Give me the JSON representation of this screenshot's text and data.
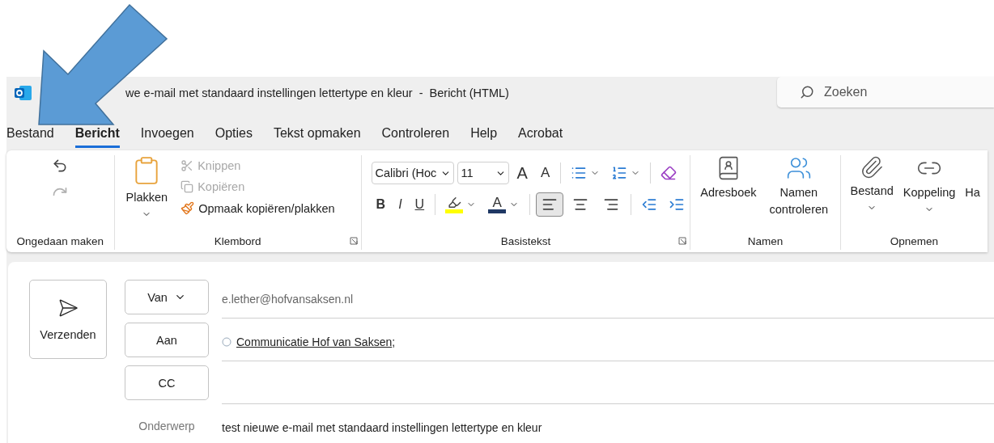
{
  "title": "we e-mail met standaard instellingen lettertype en kleur  -  Bericht (HTML)",
  "search": {
    "placeholder": "Zoeken"
  },
  "tabs": [
    {
      "label": "Bestand",
      "selected": false
    },
    {
      "label": "Bericht",
      "selected": true
    },
    {
      "label": "Invoegen",
      "selected": false
    },
    {
      "label": "Opties",
      "selected": false
    },
    {
      "label": "Tekst opmaken",
      "selected": false
    },
    {
      "label": "Controleren",
      "selected": false
    },
    {
      "label": "Help",
      "selected": false
    },
    {
      "label": "Acrobat",
      "selected": false
    }
  ],
  "ribbon": {
    "undo": {
      "label": "Ongedaan maken",
      "undo_disabled": false,
      "redo_disabled": true
    },
    "clipboard": {
      "label": "Klembord",
      "paste": "Plakken",
      "items": [
        {
          "kind": "cut",
          "label": "Knippen",
          "disabled": true
        },
        {
          "kind": "copy",
          "label": "Kopiëren",
          "disabled": true
        },
        {
          "kind": "painter",
          "label": "Opmaak kopiëren/plakken",
          "disabled": false
        }
      ]
    },
    "text": {
      "label": "Basistekst",
      "font": "Calibri (Hoc",
      "size": "11",
      "font_buttons": [
        {
          "kind": "grow",
          "glyph": "A"
        },
        {
          "kind": "shrink",
          "glyph": "A"
        }
      ],
      "format": [
        {
          "kind": "bold",
          "glyph": "B"
        },
        {
          "kind": "italic",
          "glyph": "I"
        },
        {
          "kind": "underline",
          "glyph": "U"
        }
      ],
      "font_color": {
        "glyph": "A"
      },
      "alignment": [
        {
          "kind": "left",
          "selected": true
        },
        {
          "kind": "center",
          "selected": false
        },
        {
          "kind": "right",
          "selected": false
        }
      ]
    },
    "names": {
      "label": "Namen",
      "buttons": [
        {
          "kind": "addressbook",
          "lines": [
            "Adresboek"
          ]
        },
        {
          "kind": "checknames",
          "lines": [
            "Namen",
            "controleren"
          ]
        }
      ]
    },
    "include": {
      "label": "Opnemen",
      "buttons": [
        {
          "kind": "file",
          "label": "Bestand"
        },
        {
          "kind": "link",
          "label": "Koppeling"
        },
        {
          "kind": "cut",
          "label": "Ha"
        }
      ]
    }
  },
  "compose": {
    "send": "Verzenden",
    "from": {
      "label": "Van",
      "value": "e.lether@hofvansaksen.nl"
    },
    "to": {
      "label": "Aan",
      "recipient": "Communicatie Hof van Saksen",
      "separator": ";"
    },
    "cc": {
      "label": "CC"
    },
    "subject": {
      "label": "Onderwerp",
      "value": "test nieuwe e-mail met standaard instellingen lettertype en kleur"
    }
  }
}
